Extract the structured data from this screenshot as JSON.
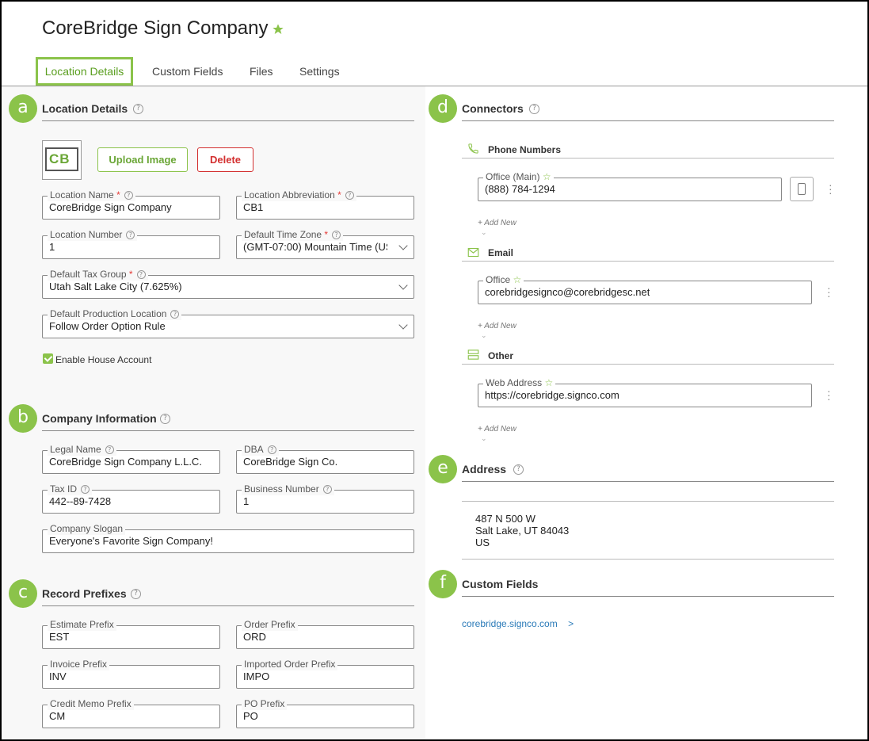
{
  "page": {
    "title": "CoreBridge Sign Company"
  },
  "tabs": [
    {
      "label": "Location Details"
    },
    {
      "label": "Custom Fields"
    },
    {
      "label": "Files"
    },
    {
      "label": "Settings"
    }
  ],
  "badges": {
    "a": "a",
    "b": "b",
    "c": "c",
    "d": "d",
    "e": "e",
    "f": "f"
  },
  "location_details": {
    "title": "Location Details",
    "logo_text": "CB",
    "upload_label": "Upload Image",
    "delete_label": "Delete",
    "fields": {
      "location_name": {
        "label": "Location Name",
        "value": "CoreBridge Sign Company"
      },
      "location_abbreviation": {
        "label": "Location Abbreviation",
        "value": "CB1"
      },
      "location_number": {
        "label": "Location Number",
        "value": "1"
      },
      "default_time_zone": {
        "label": "Default Time Zone",
        "value": "(GMT-07:00) Mountain Time (US"
      },
      "default_tax_group": {
        "label": "Default Tax Group",
        "value": "Utah Salt Lake City (7.625%)"
      },
      "default_production_location": {
        "label": "Default Production Location",
        "value": "Follow Order Option Rule"
      }
    },
    "enable_house_account": "Enable House Account"
  },
  "company_information": {
    "title": "Company Information",
    "fields": {
      "legal_name": {
        "label": "Legal Name",
        "value": "CoreBridge Sign Company L.L.C."
      },
      "dba": {
        "label": "DBA",
        "value": "CoreBridge Sign Co."
      },
      "tax_id": {
        "label": "Tax ID",
        "value": "442--89-7428"
      },
      "business_number": {
        "label": "Business Number",
        "value": "1"
      },
      "company_slogan": {
        "label": "Company Slogan",
        "value": "Everyone's Favorite Sign Company!"
      }
    }
  },
  "record_prefixes": {
    "title": "Record Prefixes",
    "fields": {
      "estimate_prefix": {
        "label": "Estimate Prefix",
        "value": "EST"
      },
      "order_prefix": {
        "label": "Order Prefix",
        "value": "ORD"
      },
      "invoice_prefix": {
        "label": "Invoice Prefix",
        "value": "INV"
      },
      "imported_order_prefix": {
        "label": "Imported Order Prefix",
        "value": "IMPO"
      },
      "credit_memo_prefix": {
        "label": "Credit Memo Prefix",
        "value": "CM"
      },
      "po_prefix": {
        "label": "PO Prefix",
        "value": "PO"
      }
    }
  },
  "connectors": {
    "title": "Connectors",
    "phone": {
      "title": "Phone Numbers",
      "label": "Office (Main)",
      "value": "(888) 784-1294",
      "add_new": "+ Add New"
    },
    "email": {
      "title": "Email",
      "label": "Office",
      "value": "corebridgesignco@corebridgesc.net",
      "add_new": "+ Add New"
    },
    "other": {
      "title": "Other",
      "label": "Web Address",
      "value": "https://corebridge.signco.com",
      "add_new": "+ Add New"
    }
  },
  "address": {
    "title": "Address",
    "line1": "487 N 500 W",
    "line2": "Salt Lake, UT 84043",
    "line3": "US"
  },
  "custom_fields": {
    "title": "Custom Fields",
    "link": "corebridge.signco.com",
    "link_arrow": ">"
  },
  "colors": {
    "accent": "#8bc34a",
    "danger": "#d32f2f",
    "link": "#2a7ab8"
  }
}
